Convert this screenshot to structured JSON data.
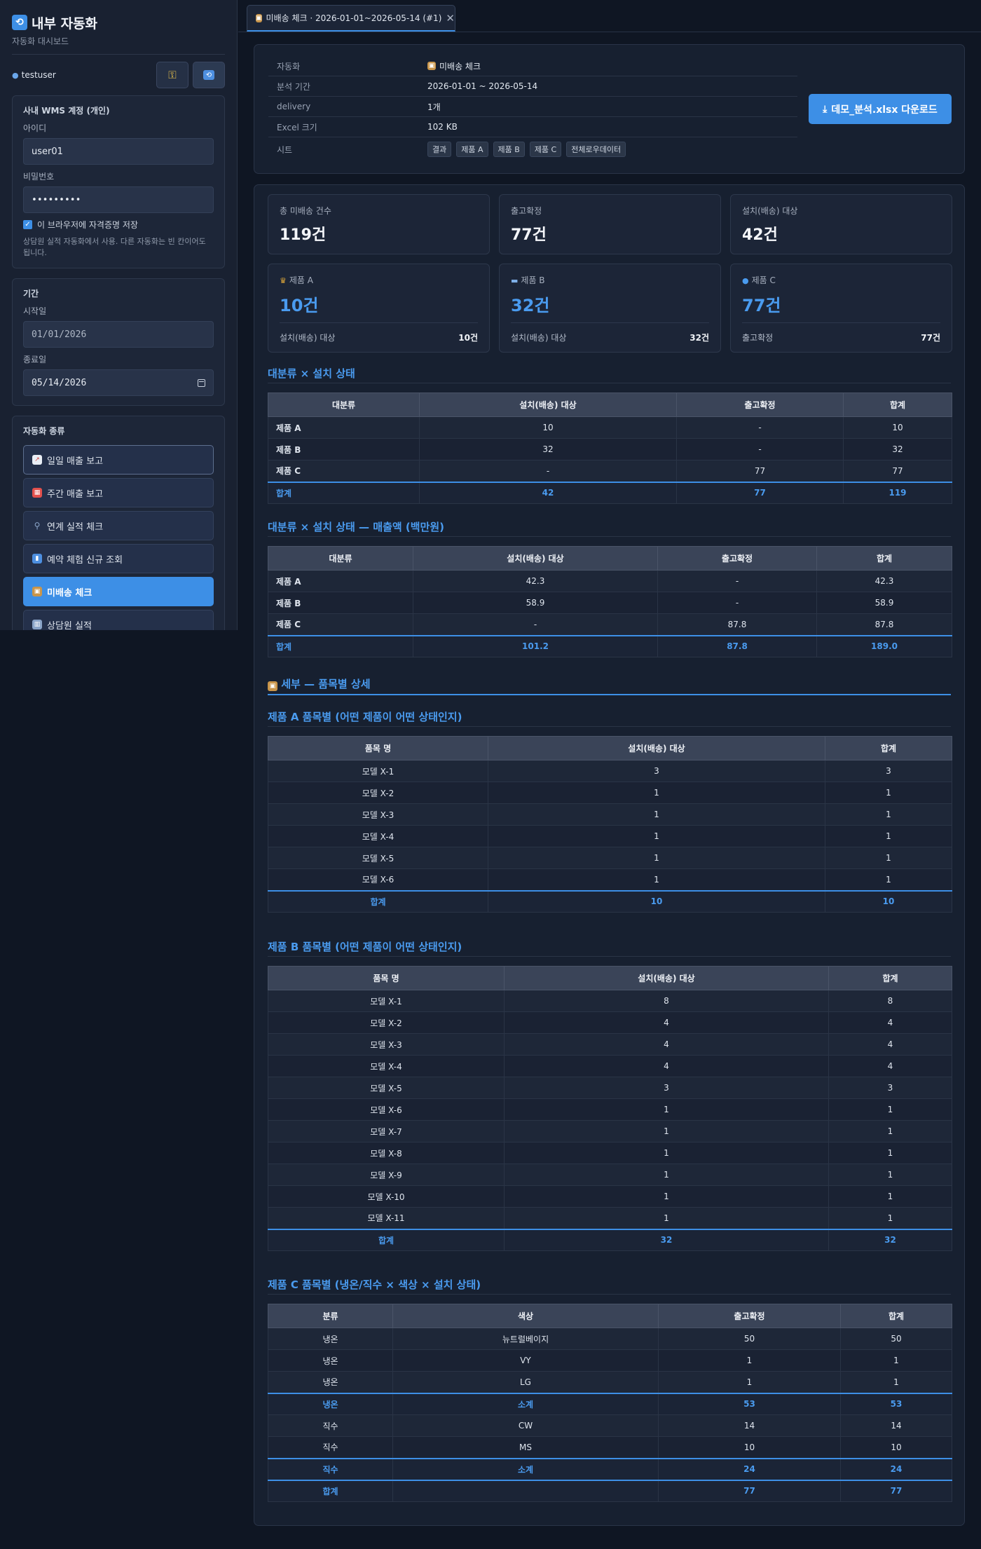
{
  "sidebar": {
    "title": "내부 자동화",
    "subtitle": "자동화 대시보드",
    "username": "testuser",
    "wms": {
      "title": "사내 WMS 계정 (개인)",
      "id_label": "아이디",
      "id_value": "user01",
      "pw_label": "비밀번호",
      "pw_value": "•••••••••",
      "remember_label": "이 브라우저에 자격증명 저장",
      "hint": "상담원 실적 자동화에서 사용. 다른 자동화는 빈 칸이어도 됩니다."
    },
    "period": {
      "title": "기간",
      "start_label": "시작일",
      "start_value": "01/01/2026",
      "end_label": "종료일",
      "end_value": "05/14/2026"
    },
    "automation": {
      "title": "자동화 종류",
      "items": [
        {
          "label": "일일 매출 보고",
          "icon": "chart-up-icon",
          "color": "#e9eef5"
        },
        {
          "label": "주간 매출 보고",
          "icon": "calendar-icon",
          "color": "#e2504c"
        },
        {
          "label": "연계 실적 체크",
          "icon": "magnifier-icon",
          "color": "#8aa4c8"
        },
        {
          "label": "예약 체험 신규 조회",
          "icon": "bar-chart-icon",
          "color": "#4d8fe0"
        },
        {
          "label": "미배송 체크",
          "icon": "package-icon",
          "color": "#c9954a"
        },
        {
          "label": "상담원 실적",
          "icon": "building-icon",
          "color": "#8aa4c8"
        }
      ]
    }
  },
  "tab": {
    "label": "미배송 체크 · 2026-01-01~2026-05-14 (#1)"
  },
  "info": {
    "rows": [
      {
        "key": "자동화",
        "value": "미배송 체크"
      },
      {
        "key": "분석 기간",
        "value": "2026-01-01 ~ 2026-05-14"
      },
      {
        "key": "delivery",
        "value": "1개"
      },
      {
        "key": "Excel 크기",
        "value": "102 KB"
      }
    ],
    "sheets_key": "시트",
    "sheets": [
      "결과",
      "제품 A",
      "제품 B",
      "제품 C",
      "전체로우데이터"
    ],
    "download_label": "데모_분석.xlsx 다운로드"
  },
  "stats": [
    {
      "label": "총 미배송 건수",
      "value": "119건"
    },
    {
      "label": "출고확정",
      "value": "77건"
    },
    {
      "label": "설치(배송) 대상",
      "value": "42건"
    }
  ],
  "products": [
    {
      "label": "제품 A",
      "value": "10건",
      "sub_label": "설치(배송) 대상",
      "sub_value": "10건",
      "icon": "trophy-icon"
    },
    {
      "label": "제품 B",
      "value": "32건",
      "sub_label": "설치(배송) 대상",
      "sub_value": "32건",
      "icon": "bed-icon"
    },
    {
      "label": "제품 C",
      "value": "77건",
      "sub_label": "출고확정",
      "sub_value": "77건",
      "icon": "droplet-icon"
    }
  ],
  "t1": {
    "title": "대분류 × 설치 상태",
    "headers": [
      "대분류",
      "설치(배송) 대상",
      "출고확정",
      "합계"
    ],
    "rows": [
      [
        "제품 A",
        "10",
        "-",
        "10"
      ],
      [
        "제품 B",
        "32",
        "-",
        "32"
      ],
      [
        "제품 C",
        "-",
        "77",
        "77"
      ]
    ],
    "total": [
      "합계",
      "42",
      "77",
      "119"
    ]
  },
  "t2": {
    "title": "대분류 × 설치 상태 — 매출액 (백만원)",
    "headers": [
      "대분류",
      "설치(배송) 대상",
      "출고확정",
      "합계"
    ],
    "rows": [
      [
        "제품 A",
        "42.3",
        "-",
        "42.3"
      ],
      [
        "제품 B",
        "58.9",
        "-",
        "58.9"
      ],
      [
        "제품 C",
        "-",
        "87.8",
        "87.8"
      ]
    ],
    "total": [
      "합계",
      "101.2",
      "87.8",
      "189.0"
    ]
  },
  "detail_title": "세부 — 품목별 상세",
  "t3": {
    "title": "제품 A 품목별 (어떤 제품이 어떤 상태인지)",
    "headers": [
      "품목 명",
      "설치(배송) 대상",
      "합계"
    ],
    "rows": [
      [
        "모델 X-1",
        "3",
        "3"
      ],
      [
        "모델 X-2",
        "1",
        "1"
      ],
      [
        "모델 X-3",
        "1",
        "1"
      ],
      [
        "모델 X-4",
        "1",
        "1"
      ],
      [
        "모델 X-5",
        "1",
        "1"
      ],
      [
        "모델 X-6",
        "1",
        "1"
      ]
    ],
    "total": [
      "합계",
      "10",
      "10"
    ]
  },
  "t4": {
    "title": "제품 B 품목별 (어떤 제품이 어떤 상태인지)",
    "headers": [
      "품목 명",
      "설치(배송) 대상",
      "합계"
    ],
    "rows": [
      [
        "모델 X-1",
        "8",
        "8"
      ],
      [
        "모델 X-2",
        "4",
        "4"
      ],
      [
        "모델 X-3",
        "4",
        "4"
      ],
      [
        "모델 X-4",
        "4",
        "4"
      ],
      [
        "모델 X-5",
        "3",
        "3"
      ],
      [
        "모델 X-6",
        "1",
        "1"
      ],
      [
        "모델 X-7",
        "1",
        "1"
      ],
      [
        "모델 X-8",
        "1",
        "1"
      ],
      [
        "모델 X-9",
        "1",
        "1"
      ],
      [
        "모델 X-10",
        "1",
        "1"
      ],
      [
        "모델 X-11",
        "1",
        "1"
      ]
    ],
    "total": [
      "합계",
      "32",
      "32"
    ]
  },
  "t5": {
    "title": "제품 C 품목별 (냉온/직수 × 색상 × 설치 상태)",
    "headers": [
      "분류",
      "색상",
      "출고확정",
      "합계"
    ],
    "rows": [
      {
        "cells": [
          "냉온",
          "뉴트럴베이지",
          "50",
          "50"
        ],
        "kind": "row"
      },
      {
        "cells": [
          "냉온",
          "VY",
          "1",
          "1"
        ],
        "kind": "row"
      },
      {
        "cells": [
          "냉온",
          "LG",
          "1",
          "1"
        ],
        "kind": "row"
      },
      {
        "cells": [
          "냉온",
          "소계",
          "53",
          "53"
        ],
        "kind": "sub"
      },
      {
        "cells": [
          "직수",
          "CW",
          "14",
          "14"
        ],
        "kind": "row"
      },
      {
        "cells": [
          "직수",
          "MS",
          "10",
          "10"
        ],
        "kind": "row"
      },
      {
        "cells": [
          "직수",
          "소계",
          "24",
          "24"
        ],
        "kind": "sub"
      },
      {
        "cells": [
          "합계",
          "",
          "77",
          "77"
        ],
        "kind": "tot"
      }
    ]
  },
  "colors": {
    "accent": "#3d8fe6",
    "background": "#0f1623",
    "card": "#172030"
  }
}
